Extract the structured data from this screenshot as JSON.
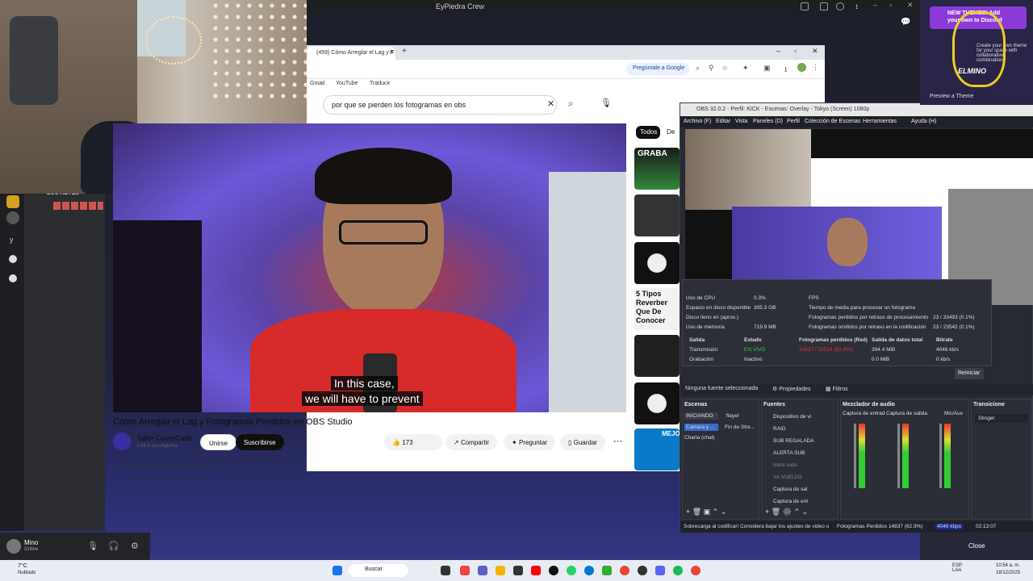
{
  "discord": {
    "window_title": "EyPiedra Crew",
    "server_label": "LOS REYES",
    "user": {
      "name": "Mino",
      "status": "Online"
    }
  },
  "browser": {
    "tab_title": "(459) Cómo Arreglar el Lag y F",
    "ask_google": "Pregúntale a Google",
    "bookmarks": [
      "Gmail",
      "YouTube",
      "Traducir"
    ]
  },
  "youtube": {
    "search_query": "por que se pierden los fotogramas en obs",
    "caption_line1": "In this case,",
    "caption_line2": "we will have to prevent",
    "video_title": "Cómo Arreglar el Lag y Fotogramas Perdidos en OBS Studio",
    "channel_name": "Taller CoverCade",
    "subscribers": "3,59 K suscriptores",
    "join_label": "Unirse",
    "subscribe_label": "Suscribirse",
    "likes": "173",
    "share_label": "Compartir",
    "ask_label": "Preguntar",
    "save_label": "Guardar",
    "views_line": "8,7 K vistas  hace 1 año  GUANAJUATO",
    "chip_all": "Todos",
    "chip_2": "De",
    "side_thumb_texts": [
      "GRABA",
      "5 Tipos Reverber Que De Conocer",
      "MEJO"
    ]
  },
  "obs": {
    "title": "OBS 32.0.2 - Perfil: KICK - Escenas: Overlay - Tokyo (Screen) 1080p",
    "menu": [
      "Archivo (F)",
      "Editar",
      "Vista",
      "Paneles (D)",
      "Perfil",
      "Colección de Escenas",
      "Herramientas",
      "Ayuda (H)"
    ],
    "stats": {
      "cpu_label": "Uso de CPU",
      "cpu_value": "0.3%",
      "disk_label": "Espacio en disco disponible",
      "disk_value": "305.3 GB",
      "diskfull_label": "Disco lleno en (aprox.)",
      "diskfull_value": "",
      "mem_label": "Uso de memoria",
      "mem_value": "719.9 MB",
      "fps_label": "FPS",
      "render_label": "Tiempo de media para procesar un fotograma",
      "lag_proc_label": "Fotogramas perdidos por retraso de procesamiento",
      "lag_proc_value": "23 / 33493 (0.1%)",
      "lag_enc_label": "Fotogramas omitidos por retraso en la codificación",
      "lag_enc_value": "23 / 23542 (0.1%)",
      "headers": [
        "Salida",
        "Estado",
        "Fotogramas perdidos (Red)",
        "Salida de datos total",
        "Bitrate"
      ],
      "rows": [
        {
          "name": "Transmisión",
          "state": "EN VIVO",
          "dropped": "14837 / 23524 (62.9%)",
          "total": "394.4 MiB",
          "bitrate": "4046 kb/s"
        },
        {
          "name": "Grabación",
          "state": "Inactivo",
          "dropped": "",
          "total": "0.0 MiB",
          "bitrate": "0 kb/s"
        }
      ],
      "reset_label": "Reiniciar"
    },
    "no_source": "Ninguna fuente seleccionada",
    "props_label": "Propiedades",
    "filters_label": "Filtros",
    "scenes_title": "Escenas",
    "scenes": [
      "INICIANDO",
      "Camara y ...",
      "Charla (chat)"
    ],
    "transitions_col": [
      "flayer",
      "Fin de Stre..."
    ],
    "sources_title": "Fuentes",
    "sources": [
      "Dispositivo de vi",
      "RAID",
      "SUB REGALADA",
      "ALERTA SUB",
      "meta subs",
      "YA VUELVO",
      "Captura de sal",
      "Captura de ent"
    ],
    "mixer_title": "Mezclador de audio",
    "mixer_channels": [
      "Captura de entrad",
      "Captura de salida",
      "Mic/Aux"
    ],
    "transitions_title": "Transicione",
    "transition_value": "Stinger",
    "status_left": "Sobrecarga al codificar! Considera bajar los ajustes de video o",
    "status_dropped": "Fotogramas Perdidos 14837 (62.9%)",
    "status_bitrate": "4046 kbps",
    "status_time": "02:13:07"
  },
  "right_panel": {
    "banner": "NEW THEMES! Add your own to Discord",
    "sub": "Create your own theme for your space with collaborative combinations",
    "preview_label": "Preview a Theme",
    "logo_text": "ELMINO",
    "close_label": "Close"
  },
  "taskbar": {
    "weather_temp": "7°C",
    "weather_text": "Nublado",
    "search_label": "Buscar",
    "lang": "ESP\nLAA",
    "time": "10:54 a. m.",
    "date": "18/12/2025"
  },
  "colors": {
    "accent_red": "#cc0000",
    "discord_bg": "#1e1f22",
    "obs_bg": "#272a33",
    "subscribe_bg": "#0f0f0f"
  }
}
